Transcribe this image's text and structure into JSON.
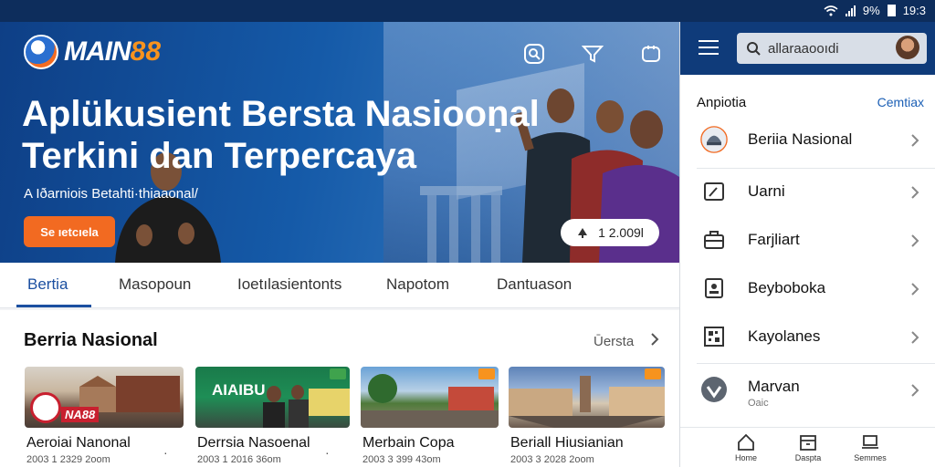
{
  "statusbar": {
    "battery": "9%",
    "time": "19:3"
  },
  "hero": {
    "brand": "MAIN",
    "brand_num": "88",
    "headline_line1": "Aplükusient Bersta Nasiooṇal",
    "headline_line2": "Terkini dan Terpercaya",
    "subline": "A Iðarniois Betahti·thiaaonal/",
    "cta_label": "Se ıetcıela",
    "viewer_count": "1 2.009l",
    "icons": [
      "search-icon",
      "filter-icon",
      "refresh-icon"
    ]
  },
  "tabs": [
    "Bertia",
    "Masopoun",
    "Ioetılasientonts",
    "Napotom",
    "Dantuason"
  ],
  "active_tab": 0,
  "section": {
    "title": "Berria Nasional",
    "more_label": "Ūersta",
    "cards": [
      {
        "title": "Aeroiai Nanonal",
        "meta": "2003 1 2329 2oom",
        "badge": "NA88"
      },
      {
        "title": "Derrsia Nasoenal",
        "meta": "2003 1 2016 36om",
        "badge": "AIAIBU"
      },
      {
        "title": "Merbain Copa",
        "meta": "2003 3 399 43om",
        "badge": ""
      },
      {
        "title": "Beriall Hiusianian",
        "meta": "2003 3 2028 2oom",
        "badge": ""
      }
    ]
  },
  "panel": {
    "search_value": "allaraaooıdi",
    "section_label": "Anpiotia",
    "section_link": "Cemtiax",
    "items": [
      {
        "label": "Beriia Nasional",
        "icon": "helmet-icon",
        "sub": ""
      },
      {
        "label": "Uarni",
        "icon": "edit-icon",
        "sub": ""
      },
      {
        "label": "Farjliart",
        "icon": "briefcase-icon",
        "sub": ""
      },
      {
        "label": "Beyboboka",
        "icon": "document-icon",
        "sub": ""
      },
      {
        "label": "Kayolanes",
        "icon": "qr-icon",
        "sub": ""
      },
      {
        "label": "Marvan",
        "icon": "user-circle-icon",
        "sub": "Oaic"
      }
    ],
    "bottom_nav": [
      "Home",
      "Daspta",
      "Semmes"
    ]
  },
  "colors": {
    "brand_blue": "#0f3b7a",
    "accent_orange": "#f26a21",
    "link_blue": "#1b5fb5"
  }
}
